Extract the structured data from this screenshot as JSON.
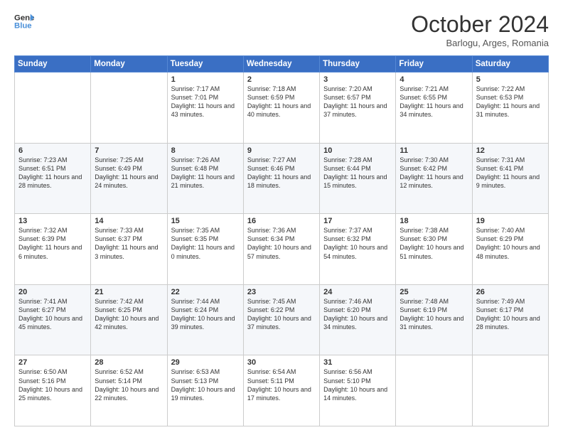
{
  "header": {
    "logo_line1": "General",
    "logo_line2": "Blue",
    "month": "October 2024",
    "location": "Barlogu, Arges, Romania"
  },
  "days_of_week": [
    "Sunday",
    "Monday",
    "Tuesday",
    "Wednesday",
    "Thursday",
    "Friday",
    "Saturday"
  ],
  "weeks": [
    [
      {
        "day": "",
        "text": ""
      },
      {
        "day": "",
        "text": ""
      },
      {
        "day": "1",
        "text": "Sunrise: 7:17 AM\nSunset: 7:01 PM\nDaylight: 11 hours and 43 minutes."
      },
      {
        "day": "2",
        "text": "Sunrise: 7:18 AM\nSunset: 6:59 PM\nDaylight: 11 hours and 40 minutes."
      },
      {
        "day": "3",
        "text": "Sunrise: 7:20 AM\nSunset: 6:57 PM\nDaylight: 11 hours and 37 minutes."
      },
      {
        "day": "4",
        "text": "Sunrise: 7:21 AM\nSunset: 6:55 PM\nDaylight: 11 hours and 34 minutes."
      },
      {
        "day": "5",
        "text": "Sunrise: 7:22 AM\nSunset: 6:53 PM\nDaylight: 11 hours and 31 minutes."
      }
    ],
    [
      {
        "day": "6",
        "text": "Sunrise: 7:23 AM\nSunset: 6:51 PM\nDaylight: 11 hours and 28 minutes."
      },
      {
        "day": "7",
        "text": "Sunrise: 7:25 AM\nSunset: 6:49 PM\nDaylight: 11 hours and 24 minutes."
      },
      {
        "day": "8",
        "text": "Sunrise: 7:26 AM\nSunset: 6:48 PM\nDaylight: 11 hours and 21 minutes."
      },
      {
        "day": "9",
        "text": "Sunrise: 7:27 AM\nSunset: 6:46 PM\nDaylight: 11 hours and 18 minutes."
      },
      {
        "day": "10",
        "text": "Sunrise: 7:28 AM\nSunset: 6:44 PM\nDaylight: 11 hours and 15 minutes."
      },
      {
        "day": "11",
        "text": "Sunrise: 7:30 AM\nSunset: 6:42 PM\nDaylight: 11 hours and 12 minutes."
      },
      {
        "day": "12",
        "text": "Sunrise: 7:31 AM\nSunset: 6:41 PM\nDaylight: 11 hours and 9 minutes."
      }
    ],
    [
      {
        "day": "13",
        "text": "Sunrise: 7:32 AM\nSunset: 6:39 PM\nDaylight: 11 hours and 6 minutes."
      },
      {
        "day": "14",
        "text": "Sunrise: 7:33 AM\nSunset: 6:37 PM\nDaylight: 11 hours and 3 minutes."
      },
      {
        "day": "15",
        "text": "Sunrise: 7:35 AM\nSunset: 6:35 PM\nDaylight: 11 hours and 0 minutes."
      },
      {
        "day": "16",
        "text": "Sunrise: 7:36 AM\nSunset: 6:34 PM\nDaylight: 10 hours and 57 minutes."
      },
      {
        "day": "17",
        "text": "Sunrise: 7:37 AM\nSunset: 6:32 PM\nDaylight: 10 hours and 54 minutes."
      },
      {
        "day": "18",
        "text": "Sunrise: 7:38 AM\nSunset: 6:30 PM\nDaylight: 10 hours and 51 minutes."
      },
      {
        "day": "19",
        "text": "Sunrise: 7:40 AM\nSunset: 6:29 PM\nDaylight: 10 hours and 48 minutes."
      }
    ],
    [
      {
        "day": "20",
        "text": "Sunrise: 7:41 AM\nSunset: 6:27 PM\nDaylight: 10 hours and 45 minutes."
      },
      {
        "day": "21",
        "text": "Sunrise: 7:42 AM\nSunset: 6:25 PM\nDaylight: 10 hours and 42 minutes."
      },
      {
        "day": "22",
        "text": "Sunrise: 7:44 AM\nSunset: 6:24 PM\nDaylight: 10 hours and 39 minutes."
      },
      {
        "day": "23",
        "text": "Sunrise: 7:45 AM\nSunset: 6:22 PM\nDaylight: 10 hours and 37 minutes."
      },
      {
        "day": "24",
        "text": "Sunrise: 7:46 AM\nSunset: 6:20 PM\nDaylight: 10 hours and 34 minutes."
      },
      {
        "day": "25",
        "text": "Sunrise: 7:48 AM\nSunset: 6:19 PM\nDaylight: 10 hours and 31 minutes."
      },
      {
        "day": "26",
        "text": "Sunrise: 7:49 AM\nSunset: 6:17 PM\nDaylight: 10 hours and 28 minutes."
      }
    ],
    [
      {
        "day": "27",
        "text": "Sunrise: 6:50 AM\nSunset: 5:16 PM\nDaylight: 10 hours and 25 minutes."
      },
      {
        "day": "28",
        "text": "Sunrise: 6:52 AM\nSunset: 5:14 PM\nDaylight: 10 hours and 22 minutes."
      },
      {
        "day": "29",
        "text": "Sunrise: 6:53 AM\nSunset: 5:13 PM\nDaylight: 10 hours and 19 minutes."
      },
      {
        "day": "30",
        "text": "Sunrise: 6:54 AM\nSunset: 5:11 PM\nDaylight: 10 hours and 17 minutes."
      },
      {
        "day": "31",
        "text": "Sunrise: 6:56 AM\nSunset: 5:10 PM\nDaylight: 10 hours and 14 minutes."
      },
      {
        "day": "",
        "text": ""
      },
      {
        "day": "",
        "text": ""
      }
    ]
  ]
}
